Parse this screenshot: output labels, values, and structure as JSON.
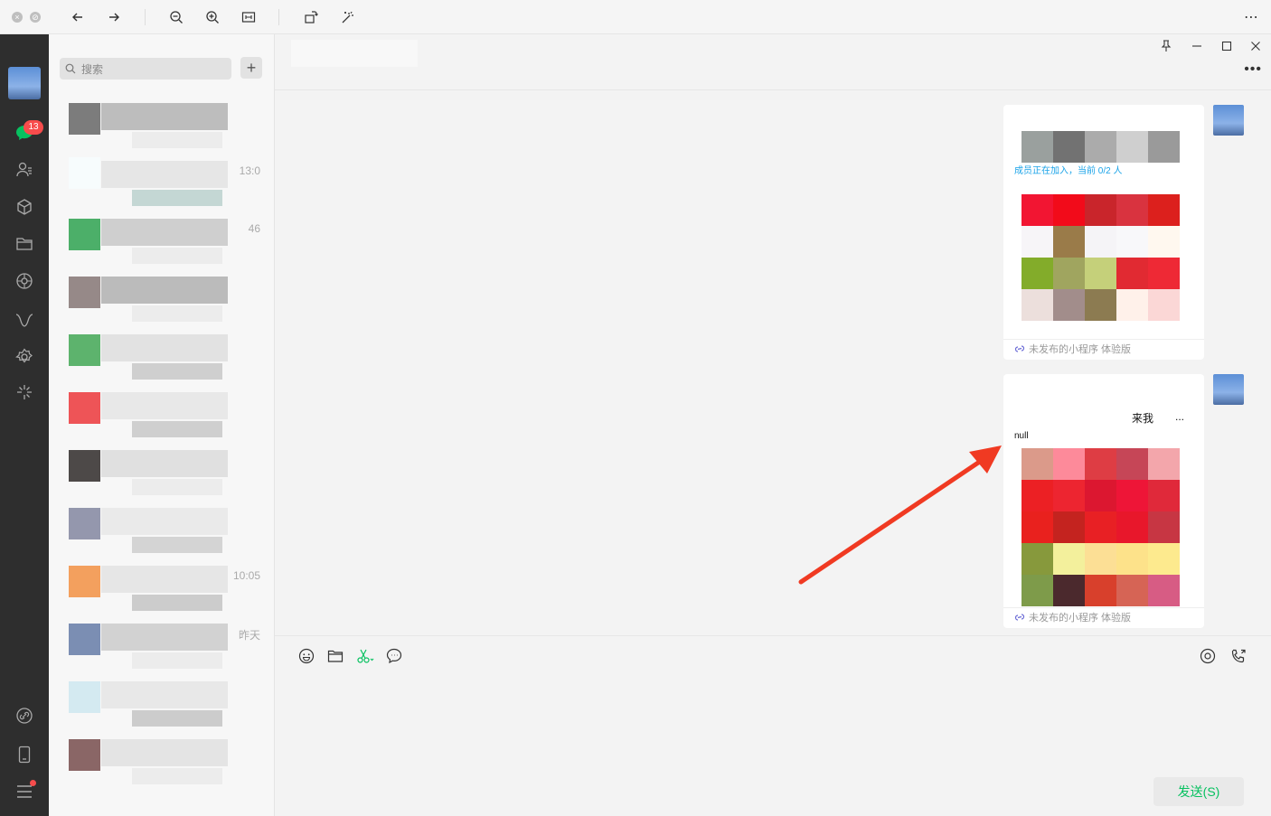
{
  "toolbar": {
    "icons": [
      "close-dot-icon",
      "stop-dot-icon",
      "back-arrow-icon",
      "forward-arrow-icon",
      "zoom-out-icon",
      "zoom-in-icon",
      "fit-icon",
      "rotate-icon",
      "magic-icon",
      "more-icon"
    ]
  },
  "rail": {
    "unread_badge": "13",
    "icons": [
      "chat-icon",
      "contacts-icon",
      "box-icon",
      "folder-icon",
      "moments-icon",
      "channels-icon",
      "settings-gear-icon",
      "miniprogram-icon",
      "link-icon",
      "phone-icon",
      "menu-icon"
    ]
  },
  "list": {
    "search_placeholder": "搜索",
    "add_label": "+",
    "conversations": [
      {
        "time": ""
      },
      {
        "time": "13:0"
      },
      {
        "time": "46"
      },
      {
        "time": ""
      },
      {
        "time": ""
      },
      {
        "time": ""
      },
      {
        "time": ""
      },
      {
        "time": ""
      },
      {
        "time": "10:05"
      },
      {
        "time": "昨天"
      },
      {
        "time": ""
      },
      {
        "time": ""
      }
    ]
  },
  "chat": {
    "messages": [
      {
        "status_text": "成员正在加入，当前 0/2 人",
        "footer": "未发布的小程序 体验版",
        "top_row": [
          "#9aa09e",
          "#727272",
          "#ababab",
          "#cfcfcf",
          "#9a9a9a"
        ],
        "grid": [
          "#f21532",
          "#f20b1a",
          "#c9252b",
          "#d9333f",
          "#dc201d",
          "#f7f5f8",
          "#9a7b49",
          "#f5f4f7",
          "#f8f8fa",
          "#fff8ef",
          "#83ac2a",
          "#a0a55f",
          "#c5d07a",
          "#e12a32",
          "#ee2935",
          "#ecdfdc",
          "#a28d8b",
          "#8c7b51",
          "#fff1ea",
          "#fbd7d6"
        ]
      },
      {
        "title_text": "来我",
        "ellipsis": "...",
        "value_text": "null",
        "footer": "未发布的小程序 体验版",
        "grid": [
          "#db9a8a",
          "#fd8a9a",
          "#de3d44",
          "#c64657",
          "#f3a6ab",
          "#ec2024",
          "#ed2530",
          "#dc1730",
          "#ee1537",
          "#e0293a",
          "#e9211e",
          "#c4231f",
          "#e82024",
          "#e8172b",
          "#c73643",
          "#87993c",
          "#f3f09c",
          "#fcdf95",
          "#fde28a",
          "#fdea8e",
          "#7e9b4a",
          "#4b292d",
          "#d8402c",
          "#d66455",
          "#d75c84"
        ]
      }
    ]
  },
  "input": {
    "send_label": "发送(S)"
  },
  "annotation": {
    "arrow_color": "#f03a22"
  }
}
